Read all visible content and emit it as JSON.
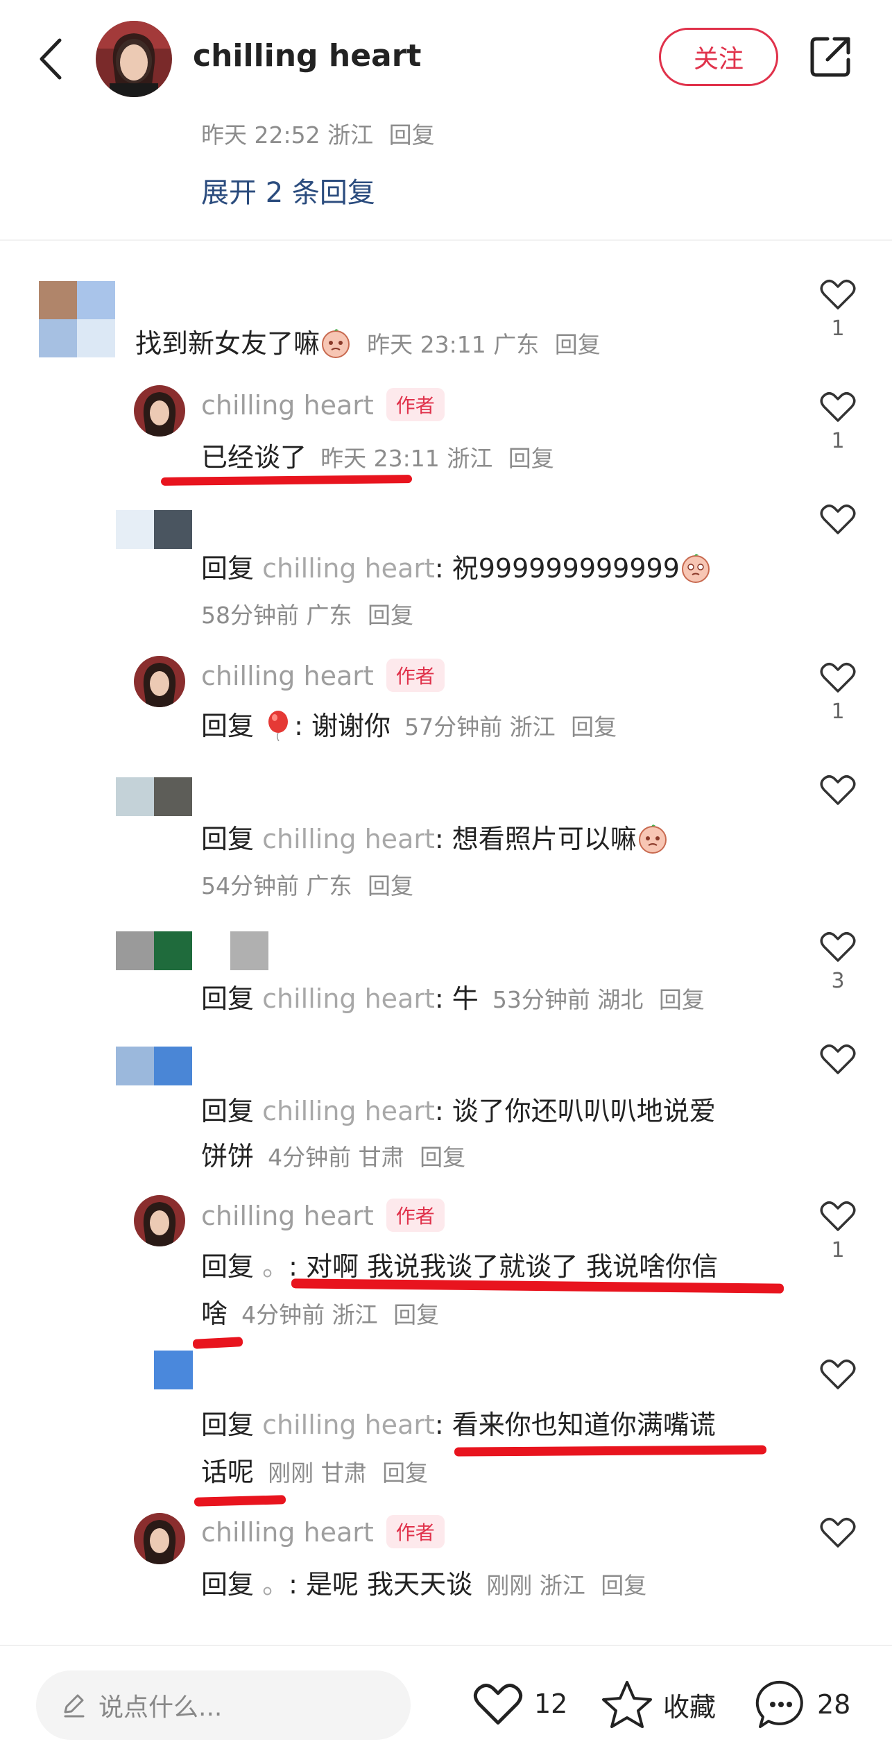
{
  "header": {
    "title": "chilling heart",
    "follow_label": "关注"
  },
  "prev_thread": {
    "meta": {
      "time": "昨天 22:52",
      "location": "浙江",
      "reply": "回复"
    },
    "expand": "展开 2 条回复"
  },
  "comments": [
    {
      "text": "找到新女友了嘛",
      "time": "昨天 23:11",
      "location": "广东",
      "reply": "回复",
      "likes": "1"
    },
    {
      "name": "chilling heart",
      "badge": "作者",
      "text": "已经谈了",
      "time": "昨天 23:11",
      "location": "浙江",
      "reply": "回复",
      "likes": "1"
    },
    {
      "prefix": "回复",
      "target": "chilling heart",
      "text": ": 祝999999999999",
      "time": "58分钟前",
      "location": "广东",
      "reply": "回复",
      "likes": ""
    },
    {
      "name": "chilling heart",
      "badge": "作者",
      "prefix": "回复",
      "text": ": 谢谢你",
      "time": "57分钟前",
      "location": "浙江",
      "reply": "回复",
      "likes": "1"
    },
    {
      "prefix": "回复",
      "target": "chilling heart",
      "text": ": 想看照片可以嘛",
      "time": "54分钟前",
      "location": "广东",
      "reply": "回复",
      "likes": ""
    },
    {
      "prefix": "回复",
      "target": "chilling heart",
      "text": ": 牛",
      "time": "53分钟前",
      "location": "湖北",
      "reply": "回复",
      "likes": "3"
    },
    {
      "prefix": "回复",
      "target": "chilling heart",
      "text": ": 谈了你还叭叭叭地说爱",
      "text2": "饼饼",
      "time": "4分钟前",
      "location": "甘肃",
      "reply": "回复",
      "likes": ""
    },
    {
      "name": "chilling heart",
      "badge": "作者",
      "prefix": "回复",
      "target": "。",
      "text": ": 对啊 我说我谈了就谈了 我说啥你信",
      "text2": "啥",
      "time": "4分钟前",
      "location": "浙江",
      "reply": "回复",
      "likes": "1"
    },
    {
      "prefix": "回复",
      "target": "chilling heart",
      "text": ": 看来你也知道你满嘴谎",
      "text2": "话呢",
      "time": "刚刚",
      "location": "甘肃",
      "reply": "回复",
      "likes": ""
    },
    {
      "name": "chilling heart",
      "badge": "作者",
      "prefix": "回复",
      "target": "。",
      "text": ": 是呢 我天天谈",
      "time": "刚刚",
      "location": "浙江",
      "reply": "回复",
      "likes": ""
    }
  ],
  "bottom": {
    "placeholder": "说点什么...",
    "likes": "12",
    "favorite_label": "收藏",
    "comments": "28"
  },
  "colors": {
    "accent": "#e0324b",
    "underline": "#e8141e"
  }
}
